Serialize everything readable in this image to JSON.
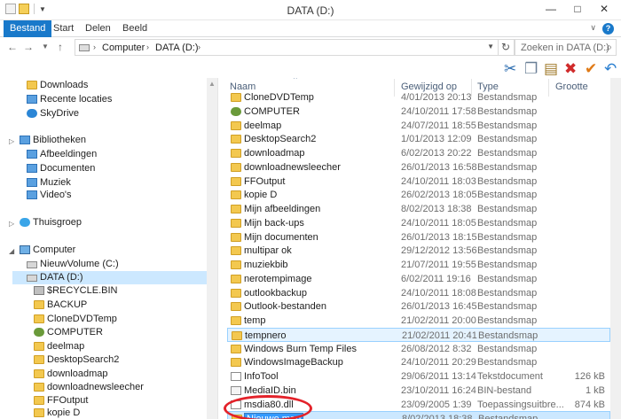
{
  "window": {
    "title": "DATA (D:)"
  },
  "ribbon": {
    "tabs": [
      "Bestand",
      "Start",
      "Delen",
      "Beeld"
    ]
  },
  "address": {
    "crumbs": [
      "Computer",
      "DATA (D:)"
    ],
    "search_placeholder": "Zoeken in DATA (D:)"
  },
  "toolbar": {
    "icons": [
      "scissors-icon",
      "copy-icon",
      "paste-icon",
      "delete-icon",
      "checkmark-icon",
      "undo-icon"
    ]
  },
  "nav_pane": {
    "favorites": [
      {
        "label": "Downloads",
        "icon": "folder"
      },
      {
        "label": "Recente locaties",
        "icon": "blue"
      },
      {
        "label": "SkyDrive",
        "icon": "cloud"
      }
    ],
    "libraries_label": "Bibliotheken",
    "libraries": [
      {
        "label": "Afbeeldingen",
        "icon": "blue"
      },
      {
        "label": "Documenten",
        "icon": "blue"
      },
      {
        "label": "Muziek",
        "icon": "blue"
      },
      {
        "label": "Video's",
        "icon": "blue"
      }
    ],
    "homegroup_label": "Thuisgroep",
    "computer_label": "Computer",
    "drives": [
      {
        "label": "NieuwVolume (C:)",
        "icon": "drive"
      },
      {
        "label": "DATA (D:)",
        "icon": "drive"
      }
    ],
    "data_children": [
      {
        "label": "$RECYCLE.BIN",
        "icon": "recyc"
      },
      {
        "label": "BACKUP",
        "icon": "folder"
      },
      {
        "label": "CloneDVDTemp",
        "icon": "folder"
      },
      {
        "label": "COMPUTER",
        "icon": "gear"
      },
      {
        "label": "deelmap",
        "icon": "folder"
      },
      {
        "label": "DesktopSearch2",
        "icon": "folder"
      },
      {
        "label": "downloadmap",
        "icon": "folder"
      },
      {
        "label": "downloadnewsleecher",
        "icon": "folder"
      },
      {
        "label": "FFOutput",
        "icon": "folder"
      },
      {
        "label": "kopie D",
        "icon": "folder"
      }
    ]
  },
  "list": {
    "columns": {
      "name": "Naam",
      "date": "Gewijzigd op",
      "type": "Type",
      "size": "Grootte"
    },
    "rows": [
      {
        "name": "CloneDVDTemp",
        "date": "4/01/2013 20:13",
        "type": "Bestandsmap",
        "size": "",
        "icon": "folder"
      },
      {
        "name": "COMPUTER",
        "date": "24/10/2011 17:58",
        "type": "Bestandsmap",
        "size": "",
        "icon": "gear"
      },
      {
        "name": "deelmap",
        "date": "24/07/2011 18:55",
        "type": "Bestandsmap",
        "size": "",
        "icon": "folder"
      },
      {
        "name": "DesktopSearch2",
        "date": "1/01/2013 12:09",
        "type": "Bestandsmap",
        "size": "",
        "icon": "folder"
      },
      {
        "name": "downloadmap",
        "date": "6/02/2013 20:22",
        "type": "Bestandsmap",
        "size": "",
        "icon": "folder"
      },
      {
        "name": "downloadnewsleecher",
        "date": "26/01/2013 16:58",
        "type": "Bestandsmap",
        "size": "",
        "icon": "folder"
      },
      {
        "name": "FFOutput",
        "date": "24/10/2011 18:03",
        "type": "Bestandsmap",
        "size": "",
        "icon": "folder"
      },
      {
        "name": "kopie D",
        "date": "26/02/2013 18:05",
        "type": "Bestandsmap",
        "size": "",
        "icon": "folder"
      },
      {
        "name": "Mijn afbeeldingen",
        "date": "8/02/2013 18:38",
        "type": "Bestandsmap",
        "size": "",
        "icon": "folder"
      },
      {
        "name": "Mijn back-ups",
        "date": "24/10/2011 18:05",
        "type": "Bestandsmap",
        "size": "",
        "icon": "folder"
      },
      {
        "name": "Mijn documenten",
        "date": "26/01/2013 18:15",
        "type": "Bestandsmap",
        "size": "",
        "icon": "folder"
      },
      {
        "name": "multipar ok",
        "date": "29/12/2012 13:56",
        "type": "Bestandsmap",
        "size": "",
        "icon": "folder"
      },
      {
        "name": "muziekbib",
        "date": "21/07/2011 19:55",
        "type": "Bestandsmap",
        "size": "",
        "icon": "folder"
      },
      {
        "name": "nerotempimage",
        "date": "6/02/2011 19:16",
        "type": "Bestandsmap",
        "size": "",
        "icon": "folder"
      },
      {
        "name": "outlookbackup",
        "date": "24/10/2011 18:08",
        "type": "Bestandsmap",
        "size": "",
        "icon": "folder"
      },
      {
        "name": "Outlook-bestanden",
        "date": "26/01/2013 16:45",
        "type": "Bestandsmap",
        "size": "",
        "icon": "folder"
      },
      {
        "name": "temp",
        "date": "21/02/2011 20:00",
        "type": "Bestandsmap",
        "size": "",
        "icon": "folder"
      },
      {
        "name": "tempnero",
        "date": "21/02/2011 20:41",
        "type": "Bestandsmap",
        "size": "",
        "icon": "folder"
      },
      {
        "name": "Windows Burn Temp Files",
        "date": "26/08/2012 8:32",
        "type": "Bestandsmap",
        "size": "",
        "icon": "folder"
      },
      {
        "name": "WindowsImageBackup",
        "date": "24/10/2011 20:29",
        "type": "Bestandsmap",
        "size": "",
        "icon": "folder"
      },
      {
        "name": "InfoTool",
        "date": "29/06/2011 13:14",
        "type": "Tekstdocument",
        "size": "126 kB",
        "icon": "doc"
      },
      {
        "name": "MediaID.bin",
        "date": "23/10/2011 16:24",
        "type": "BIN-bestand",
        "size": "1 kB",
        "icon": "bin"
      },
      {
        "name": "msdia80.dll",
        "date": "23/09/2005 1:39",
        "type": "Toepassingsuitbre...",
        "size": "874 kB",
        "icon": "doc"
      },
      {
        "name": "Nieuwe map",
        "date": "8/02/2013 18:38",
        "type": "Bestandsmap",
        "size": "",
        "icon": "folder"
      }
    ]
  }
}
